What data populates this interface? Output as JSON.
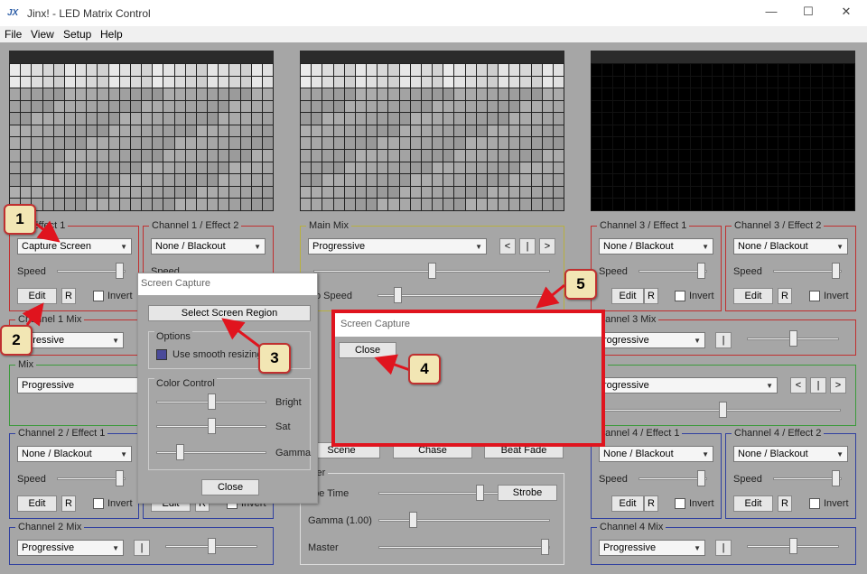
{
  "window": {
    "logo": "JX",
    "title": "Jinx! - LED Matrix Control",
    "controls": {
      "minimize": "—",
      "maximize": "☐",
      "close": "✕"
    }
  },
  "menu": [
    "File",
    "View",
    "Setup",
    "Help"
  ],
  "colors": {
    "accent_red": "#c03030",
    "callout_fill": "#f2e6b4",
    "highlight_red": "#e0141e"
  },
  "matrices": {
    "left": "preview",
    "middle": "preview",
    "right": "black"
  },
  "ch1e1": {
    "label": "1 / Effect 1",
    "effect": "Capture Screen",
    "speed": "Speed",
    "edit": "Edit",
    "r": "R",
    "invert": "Invert",
    "speed_value": 0.95
  },
  "ch1e2": {
    "label": "Channel 1 / Effect 2",
    "effect": "None / Blackout",
    "speed": "Speed"
  },
  "ch1mix": {
    "label": "Channel 1 Mix",
    "mode": "ogressive"
  },
  "mix1": {
    "label": "Mix",
    "mode": "Progressive"
  },
  "ch2e1": {
    "label": "Channel 2 / Effect 1",
    "effect": "None / Blackout",
    "speed": "Speed",
    "edit": "Edit",
    "r": "R",
    "invert": "Invert"
  },
  "ch2e2": {
    "edit": "Edit",
    "r": "R",
    "invert": "Invert"
  },
  "ch2mix": {
    "label": "Channel 2 Mix",
    "mode": "Progressive",
    "btn": "|"
  },
  "mainmix": {
    "label": "Main Mix",
    "mode": "Progressive",
    "prev": "<",
    "pause": "|",
    "next": ">",
    "speed": "o Speed"
  },
  "ch3e1": {
    "label": "Channel 3 / Effect 1",
    "effect": "None / Blackout",
    "speed": "Speed",
    "edit": "Edit",
    "r": "R",
    "invert": "Invert"
  },
  "ch3e2": {
    "label": "Channel 3 / Effect 2",
    "effect": "None / Blackout",
    "speed": "Speed",
    "edit": "Edit",
    "r": "R",
    "invert": "Invert"
  },
  "ch3mix": {
    "label": "hannel 3 Mix",
    "mode": "rogressive",
    "btn": "|"
  },
  "mix2": {
    "label": "x",
    "mode": "rogressive",
    "prev": "<",
    "pause": "|",
    "next": ">"
  },
  "ch4e1": {
    "label": "hannel 4 / Effect 1",
    "effect": "None / Blackout",
    "speed": "Speed",
    "edit": "Edit",
    "r": "R",
    "invert": "Invert"
  },
  "ch4e2": {
    "label": "Channel 4 / Effect 2",
    "effect": "None / Blackout",
    "speed": "Speed",
    "edit": "Edit",
    "r": "R",
    "invert": "Invert"
  },
  "ch4mix": {
    "label": "Channel 4 Mix",
    "mode": "Progressive",
    "btn": "|"
  },
  "master": {
    "label": "ster",
    "strobe_time": "obe Time",
    "strobe": "Strobe",
    "gamma": "Gamma (1.00)",
    "master": "Master",
    "hidden_btn1": "Scene",
    "hidden_btn2": "Chase",
    "hidden_btn3": "Beat Fade"
  },
  "dialog1": {
    "title": "Screen Capture",
    "select_region": "Select Screen Region",
    "options": "Options",
    "smooth": "Use smooth resizing",
    "color_control": "Color Control",
    "bright": "Bright",
    "sat": "Sat",
    "gamma": "Gamma",
    "close": "Close"
  },
  "dialog2": {
    "title": "Screen Capture",
    "close": "Close"
  },
  "callouts": [
    "1",
    "2",
    "3",
    "4",
    "5"
  ]
}
